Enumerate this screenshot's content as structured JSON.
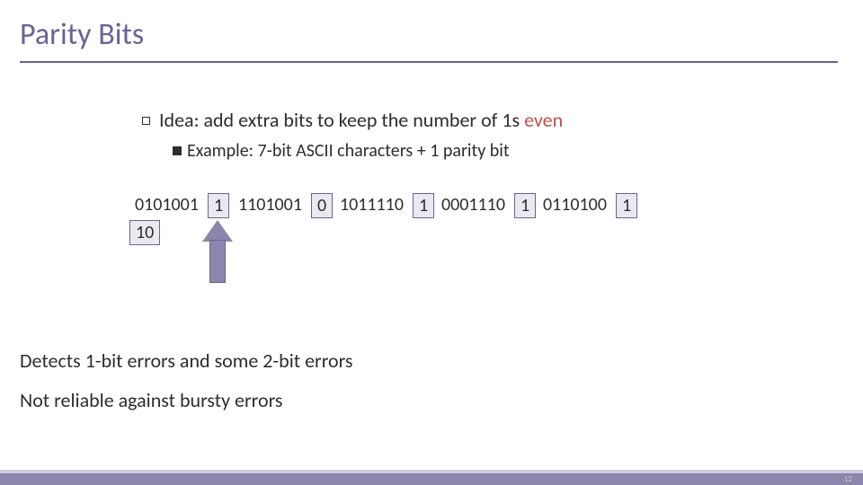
{
  "title": "Parity Bits",
  "bullet": {
    "prefix": "Idea: add extra bits to keep the number of 1s ",
    "accent": "even"
  },
  "sub_bullet": {
    "label": "Example:",
    "rest": " 7-bit ASCII characters + 1 parity bit"
  },
  "bits_groups": [
    {
      "data": "0101001",
      "parity": "1"
    },
    {
      "data": "1101001",
      "parity": "0"
    },
    {
      "data": "1011110",
      "parity": "1"
    },
    {
      "data": "0001110",
      "parity": "1"
    },
    {
      "data": "0110100",
      "parity": "1"
    }
  ],
  "overflow_box": "10",
  "lower_lines": [
    "Detects 1-bit errors and some 2-bit errors",
    "Not reliable against bursty errors"
  ],
  "slide_number": "12"
}
